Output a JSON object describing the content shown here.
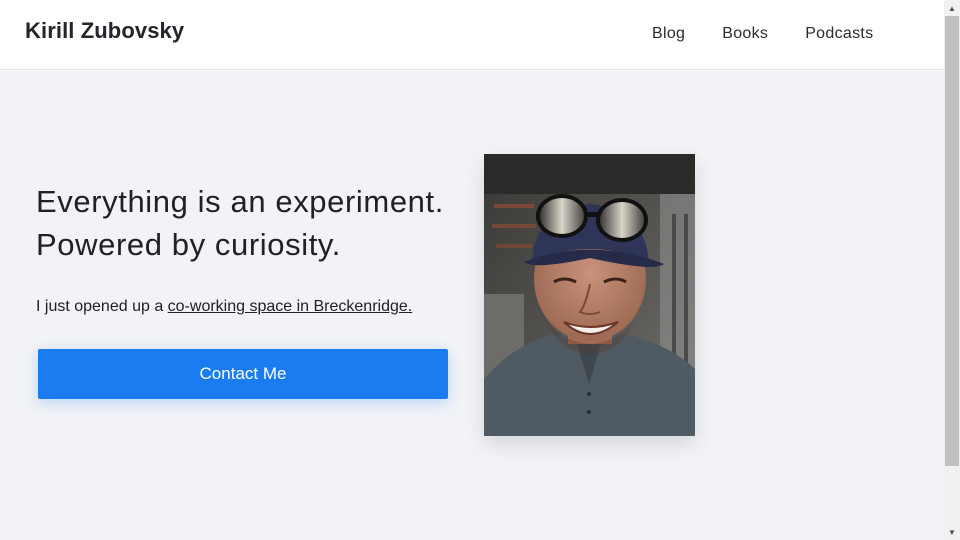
{
  "header": {
    "site_title": "Kirill Zubovsky",
    "nav": {
      "blog": "Blog",
      "books": "Books",
      "podcasts": "Podcasts"
    }
  },
  "hero": {
    "heading_line1": "Everything is an experiment.",
    "heading_line2": "Powered by curiosity.",
    "intro_prefix": "I just opened up a ",
    "intro_link": "co-working space in Breckenridge.",
    "contact_button": "Contact Me"
  },
  "colors": {
    "accent": "#1a7cf0",
    "page_background": "#f1f3f6",
    "header_background": "#ffffff"
  },
  "icons": {
    "scroll_up": "triangle-up-icon",
    "scroll_down": "triangle-down-icon"
  },
  "scrollbar": {
    "up_glyph": "▲",
    "down_glyph": "▼"
  }
}
